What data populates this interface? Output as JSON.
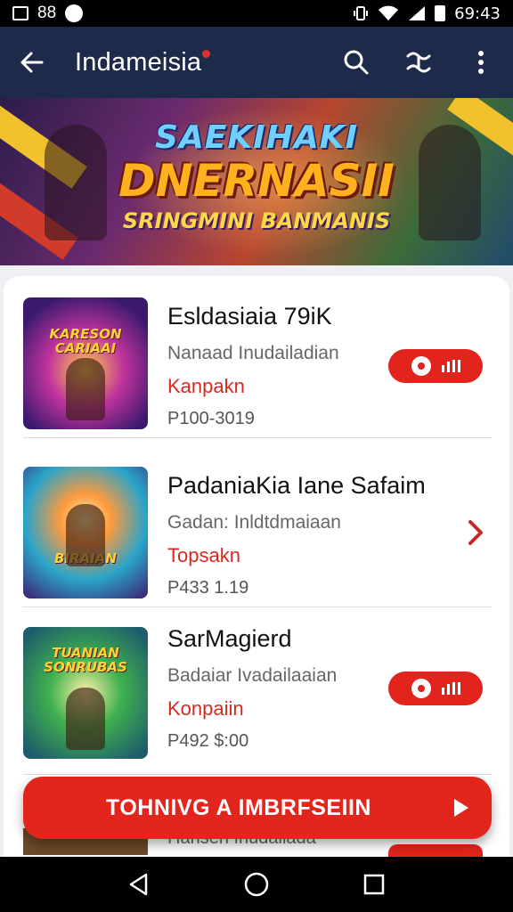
{
  "status_bar": {
    "left_text": "88",
    "time": "69:43",
    "icons": [
      "image-icon",
      "notification-dot-icon",
      "vibrate-icon",
      "wifi-icon",
      "signal-icon",
      "battery-icon"
    ]
  },
  "app_bar": {
    "title": "Indameisia",
    "icons": [
      "back-arrow-icon",
      "search-icon",
      "share-icon",
      "more-vert-icon"
    ]
  },
  "banner": {
    "line1": "SAEKIHAKI",
    "line2": "DNERNASII",
    "line3": "SRINGMINI BANMANIS"
  },
  "games": [
    {
      "title": "Esldasiaia 79iK",
      "subtitle": "Nanaad Inudailadian",
      "tag": "Kanpakn",
      "price": "P100-3019",
      "thumb_caption": "KARESON CARIAAI",
      "action": "pill-button"
    },
    {
      "title": "PadaniaKia Iane Safaim",
      "subtitle": "Gadan: Inldtdmaiaan",
      "tag": "Topsakn",
      "price": "P433 1.19",
      "thumb_caption": "BIRAIAN",
      "action": "chevron"
    },
    {
      "title": "SarMagiеrd",
      "subtitle": "Badaiar Ivadailaaian",
      "tag": "Konpaiin",
      "price": "P492 $:00",
      "thumb_caption": "TUANIAN SONRUBAS",
      "action": "pill-button"
    }
  ],
  "peek": {
    "subtitle": "Hansen Inudailada"
  },
  "cta": {
    "label": "TOHNIVG A IMBRFSEIIN"
  },
  "colors": {
    "app_bar": "#1e2a4a",
    "accent_red": "#e3241d",
    "tag_red": "#d42a20"
  },
  "nav_bar": {
    "icons": [
      "back-triangle-icon",
      "home-circle-icon",
      "recents-square-icon"
    ]
  }
}
